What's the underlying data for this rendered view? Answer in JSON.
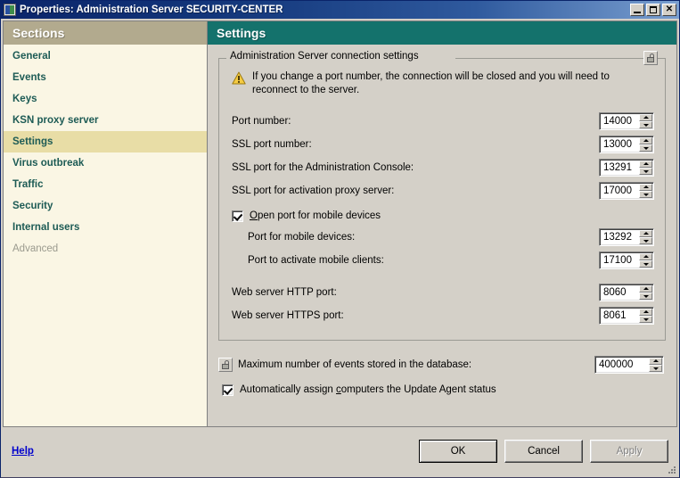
{
  "window": {
    "title": "Properties: Administration Server SECURITY-CENTER",
    "icon": "application-icon",
    "buttons": {
      "minimize": "minimize-button",
      "maximize": "maximize-button",
      "close": "close-button"
    }
  },
  "sidebar": {
    "header": "Sections",
    "items": [
      {
        "label": "General",
        "state": "normal"
      },
      {
        "label": "Events",
        "state": "normal"
      },
      {
        "label": "Keys",
        "state": "normal"
      },
      {
        "label": "KSN proxy server",
        "state": "normal"
      },
      {
        "label": "Settings",
        "state": "selected"
      },
      {
        "label": "Virus outbreak",
        "state": "normal"
      },
      {
        "label": "Traffic",
        "state": "normal"
      },
      {
        "label": "Security",
        "state": "normal"
      },
      {
        "label": "Internal users",
        "state": "normal"
      },
      {
        "label": "Advanced",
        "state": "disabled"
      }
    ]
  },
  "content": {
    "header": "Settings",
    "group": {
      "title": "Administration Server connection settings",
      "lock_icon": "padlock-icon",
      "warning": {
        "icon": "warning-triangle-icon",
        "text": "If you change a port number, the connection will be closed and you will need to reconnect to the server."
      },
      "fields": [
        {
          "label": "Port number:",
          "value": "14000",
          "indent": false
        },
        {
          "label": "SSL port number:",
          "value": "13000",
          "indent": false
        },
        {
          "label": "SSL port for the Administration Console:",
          "value": "13291",
          "indent": false
        },
        {
          "label": "SSL port for activation proxy server:",
          "value": "17000",
          "indent": false
        }
      ],
      "mobile_checkbox": {
        "label": "Open port for mobile devices",
        "accelerator": "O",
        "checked": true
      },
      "mobile_fields": [
        {
          "label": "Port for mobile devices:",
          "value": "13292",
          "indent": true
        },
        {
          "label": "Port to activate mobile clients:",
          "value": "17100",
          "indent": true
        }
      ],
      "web_fields": [
        {
          "label": "Web server HTTP port:",
          "value": "8060",
          "indent": false
        },
        {
          "label": "Web server HTTPS port:",
          "value": "8061",
          "indent": false
        }
      ]
    },
    "extra": {
      "max_events": {
        "lock_icon": "padlock-icon",
        "label": "Maximum number of events stored in the database:",
        "value": "400000"
      },
      "update_agent": {
        "label_before": "Automatically assign ",
        "accelerator": "c",
        "label_after": "omputers the Update Agent status",
        "checked": true
      }
    }
  },
  "footer": {
    "help": "Help",
    "ok": "OK",
    "cancel": "Cancel",
    "apply": "Apply",
    "apply_disabled": true,
    "resize_grip": "resize-grip-icon"
  },
  "colors": {
    "titlebar_start": "#0a246a",
    "titlebar_end": "#7a9fd0",
    "sidebar_header": "#b2aa8e",
    "sidebar_bg": "#faf6e4",
    "sidebar_selected": "#e8dda6",
    "sidebar_text": "#1d5b55",
    "content_header": "#14726c",
    "dialog_bg": "#d4d0c8",
    "link": "#0000cc",
    "warning": "#f2c12e"
  }
}
